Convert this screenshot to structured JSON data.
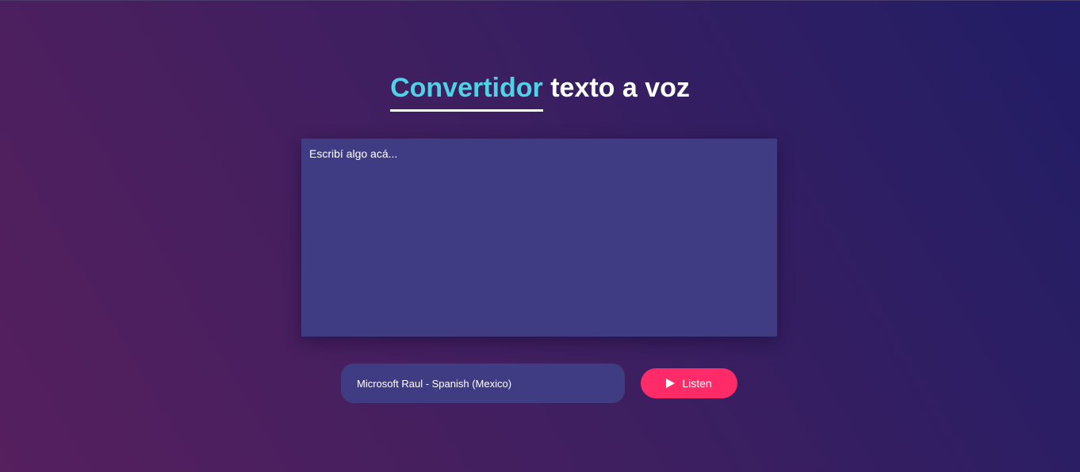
{
  "header": {
    "title_accent": "Convertidor",
    "title_rest": "texto a voz"
  },
  "editor": {
    "placeholder": "Escribí algo acá...",
    "value": ""
  },
  "voice_select": {
    "selected": "Microsoft Raul - Spanish (Mexico)"
  },
  "listen_button": {
    "label": "Listen",
    "icon": "play-icon"
  },
  "colors": {
    "accent": "#4fd1e6",
    "button": "#ff2a68",
    "panel": "#403c83"
  }
}
